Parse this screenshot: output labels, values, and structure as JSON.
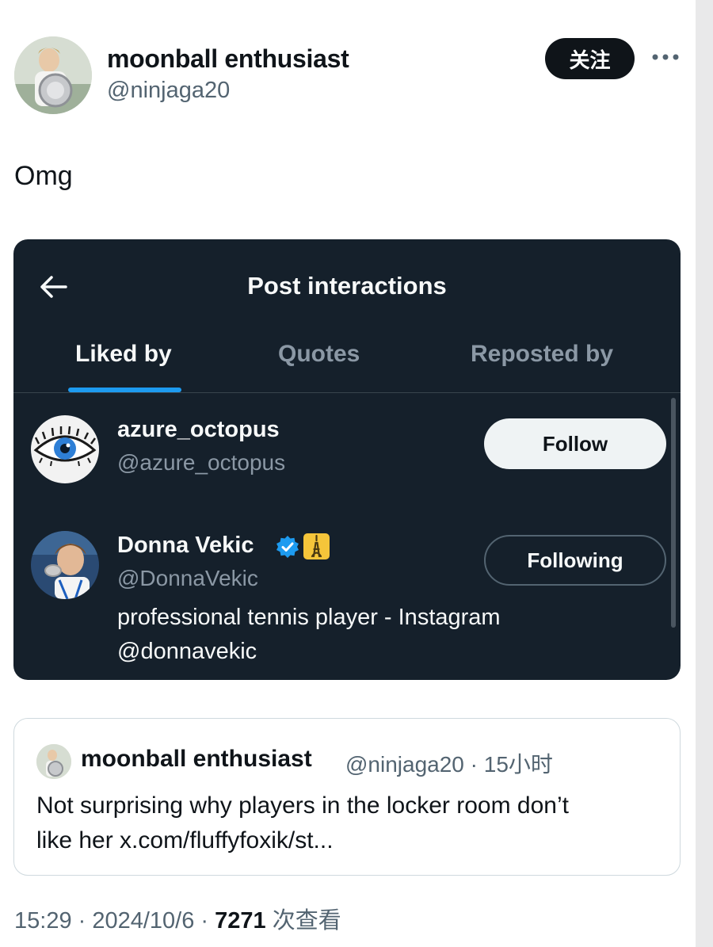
{
  "post": {
    "display_name": "moonball enthusiast",
    "handle": "@ninjaga20",
    "follow_label": "关注",
    "text": "Omg"
  },
  "embedded_screenshot": {
    "title": "Post interactions",
    "tabs": [
      {
        "label": "Liked by",
        "active": true
      },
      {
        "label": "Quotes",
        "active": false
      },
      {
        "label": "Reposted by",
        "active": false
      }
    ],
    "users": [
      {
        "name": "azure_octopus",
        "handle": "@azure_octopus",
        "button": "Follow",
        "bio": ""
      },
      {
        "name": "Donna Vekic",
        "handle": "@DonnaVekic",
        "button": "Following",
        "verified": true,
        "badge_icon": "eiffel-tower-emoji",
        "bio_line1": "professional tennis player - Instagram",
        "bio_line2": "@donnavekic"
      }
    ]
  },
  "quoted": {
    "display_name": "moonball enthusiast",
    "meta": "@ninjaga20 · 15小时",
    "text_line1": "Not surprising why players in the locker room don’t",
    "text_line2": "like her x.com/fluffyfoxik/st..."
  },
  "footer": {
    "time_date": "15:29 · 2024/10/6 · ",
    "views": "7271",
    "views_label": " 次查看"
  },
  "colors": {
    "dark_bg": "#15202b",
    "accent_blue": "#1d9bf0",
    "muted": "#536471"
  }
}
